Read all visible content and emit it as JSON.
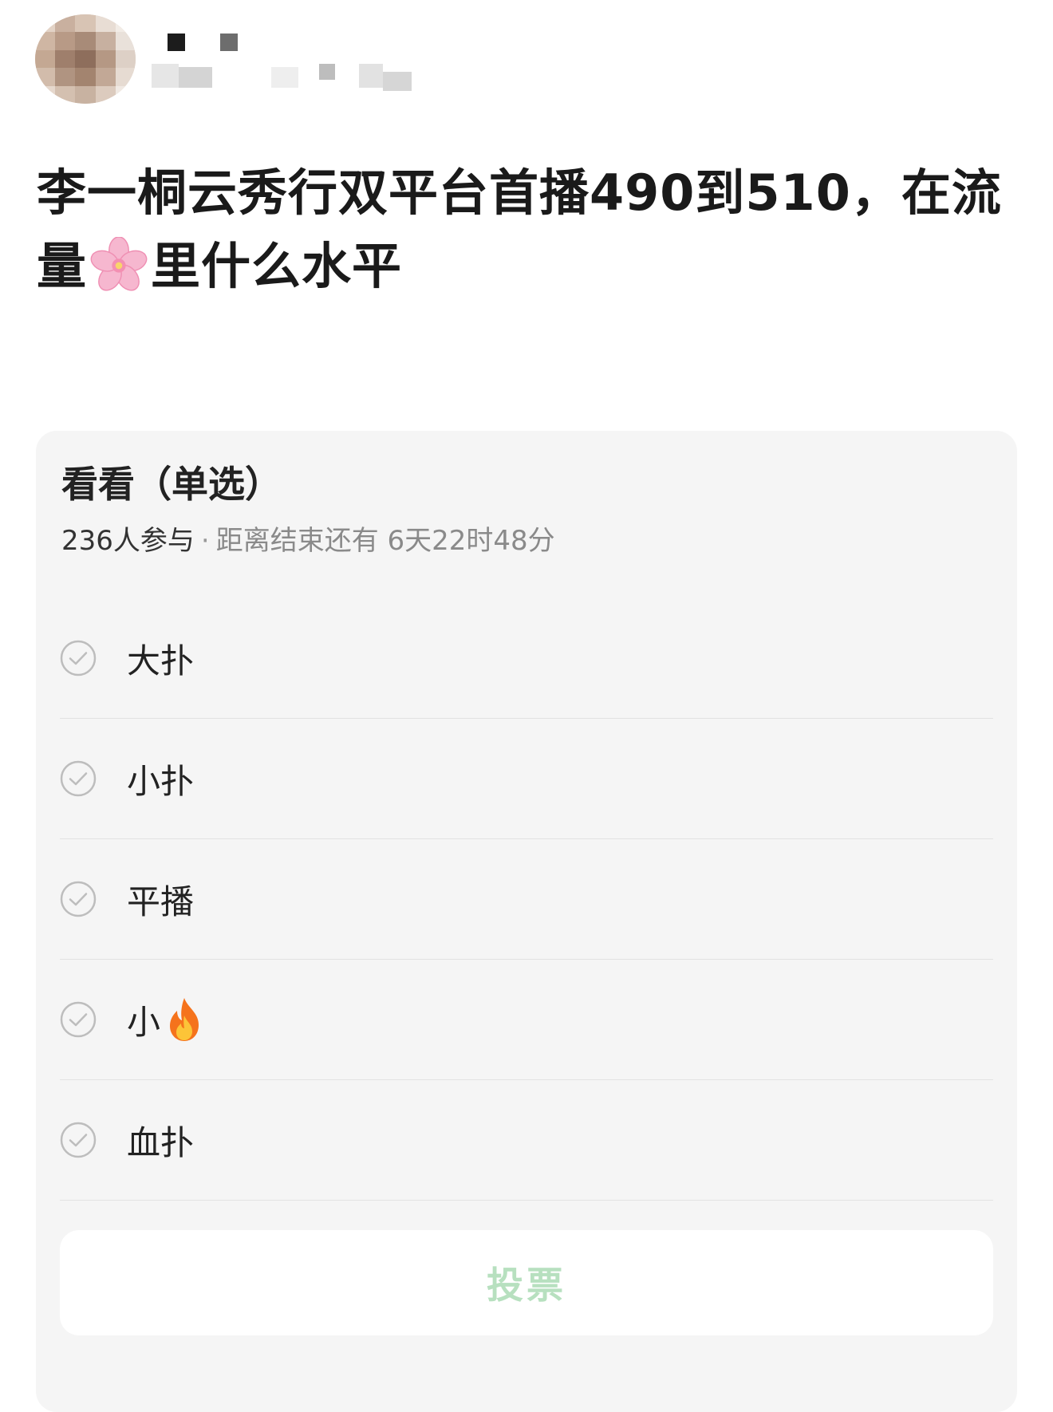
{
  "post": {
    "title_part1": "李一桐云秀行双平台首播490到510，在流量",
    "title_emoji": "cherry-blossom-icon",
    "title_part2": "里什么水平"
  },
  "poll": {
    "title": "看看（单选）",
    "participants": "236人参与",
    "separator": "·",
    "deadline": "距离结束还有 6天22时48分",
    "options": [
      {
        "label": "大扑"
      },
      {
        "label": "小扑"
      },
      {
        "label": "平播"
      },
      {
        "label": "小",
        "emoji": "fire-icon"
      },
      {
        "label": "血扑"
      }
    ],
    "vote_label": "投票"
  },
  "colors": {
    "card_background": "#f5f5f5",
    "vote_text": "#b7e0bf",
    "check_icon": "#bdbdbd",
    "divider": "#e2e2e2"
  }
}
